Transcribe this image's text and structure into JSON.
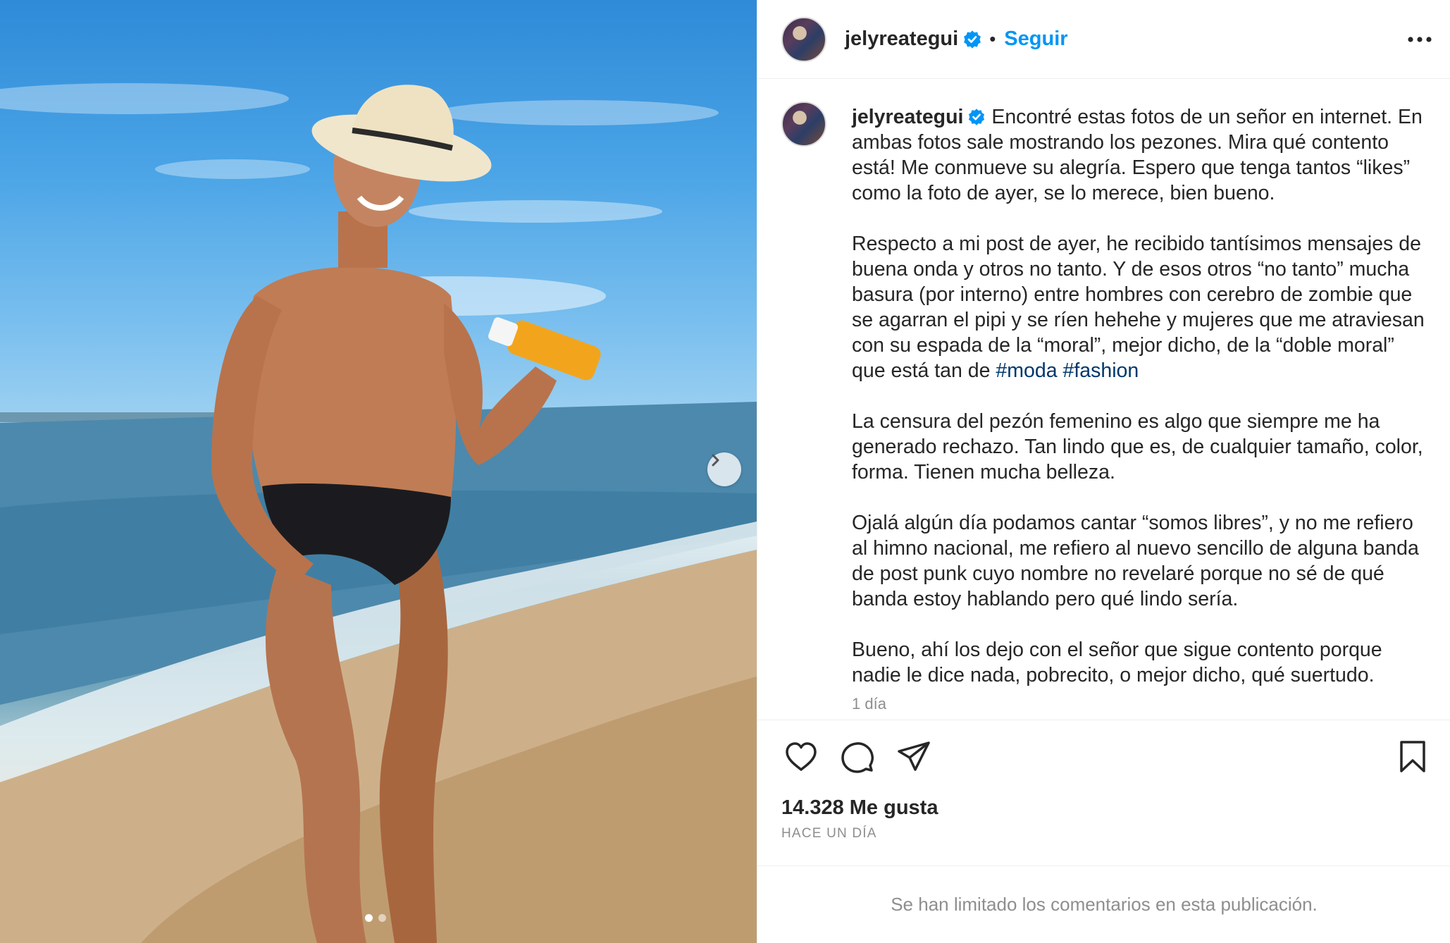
{
  "post": {
    "image_alt": "Hombre en traje de baño con sombrero aplicando protector solar en la playa",
    "carousel": {
      "total": 2,
      "current": 1
    }
  },
  "header": {
    "username": "jelyreategui",
    "separator": "•",
    "follow_label": "Seguir"
  },
  "caption": {
    "username": "jelyreategui",
    "text_before_tags": " Encontré estas fotos de un señor en internet. En ambas fotos sale mostrando los pezones. Mira qué contento está! Me conmueve su alegría. Espero que tenga tantos “likes” como la foto de ayer, se lo merece, bien bueno.\n\nRespecto a mi post de ayer, he recibido tantísimos mensajes de buena onda y otros no tanto. Y de esos otros “no tanto” mucha basura (por interno) entre hombres con cerebro de zombie que se agarran el pipi y se ríen hehehe y mujeres que me atraviesan con su espada de la “moral”, mejor dicho, de la “doble moral” que está tan de ",
    "tag1": "#moda",
    "tag2": "#fashion",
    "text_after_tags": "\n\nLa censura del pezón femenino es algo que siempre me ha generado rechazo. Tan lindo que es, de cualquier tamaño, color, forma. Tienen mucha belleza.\n\nOjalá algún día podamos cantar “somos libres”, y no me refiero al himno nacional, me refiero al nuevo sencillo de alguna banda de post punk cuyo nombre no revelaré porque no sé de qué banda estoy hablando pero qué lindo sería.\n\nBueno, ahí los dejo con el señor que sigue contento porque nadie le dice nada, pobrecito, o mejor dicho, qué suertudo.",
    "time": "1 día"
  },
  "actions": {
    "icons": [
      "heart-icon",
      "comment-icon",
      "share-icon",
      "bookmark-icon"
    ]
  },
  "stats": {
    "likes": "14.328 Me gusta",
    "posted_ago": "HACE UN DÍA"
  },
  "comments": {
    "limited_notice": "Se han limitado los comentarios en esta publicación."
  },
  "colors": {
    "accent": "#0095f6",
    "hashtag": "#00376b",
    "secondary_text": "#8e8e8e",
    "verified": "#0095f6"
  }
}
